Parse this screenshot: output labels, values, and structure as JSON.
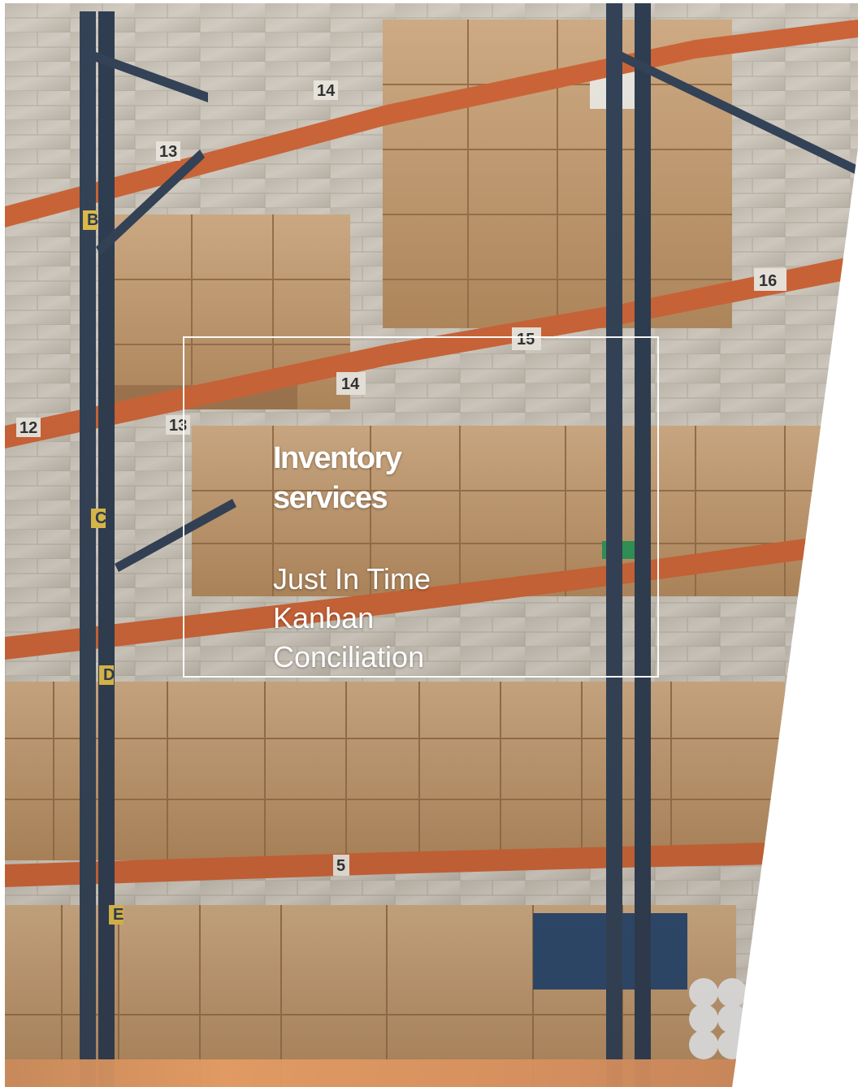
{
  "service": {
    "title": "Inventory services",
    "items": [
      "Just In Time",
      "Kanban",
      "Conciliation"
    ]
  },
  "warehouse": {
    "rack_labels": [
      "14",
      "13",
      "16",
      "15",
      "14",
      "13",
      "12",
      "5",
      "B",
      "C",
      "D",
      "E"
    ]
  },
  "colors": {
    "beam": "#d4683a",
    "upright": "#34445a",
    "box": "#c89f73",
    "wall": "#d9d3c8",
    "text": "#ffffff"
  }
}
